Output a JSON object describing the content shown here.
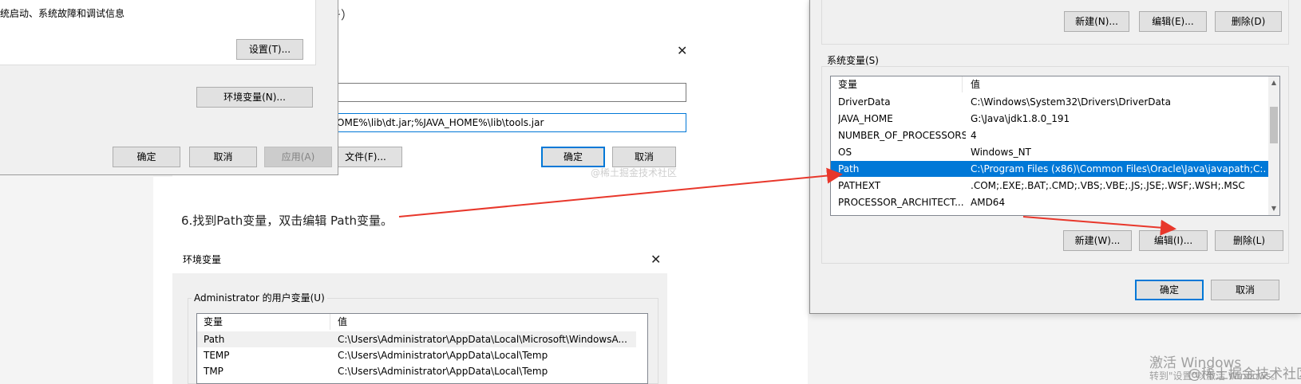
{
  "article": {
    "step_text": "6.找到Path变量，双击编辑 Path变量。",
    "top_snippet": "号）",
    "watermark": "@稀土掘金技术社区"
  },
  "sys_props": {
    "startup_text": "统启动、系统故障和调试信息",
    "settings_button": "设置(T)...",
    "env_vars_button": "环境变量(N)...",
    "ok": "确定",
    "cancel": "取消",
    "apply": "应用(A)"
  },
  "edit_var_dialog": {
    "name_value": "",
    "value_value": "HOME%\\lib\\dt.jar;%JAVA_HOME%\\lib\\tools.jar",
    "browse_file_button": "文件(F)...",
    "ok": "确定",
    "cancel": "取消"
  },
  "env_dialog_bottom": {
    "title": "环境变量",
    "user_vars_label": "Administrator 的用户变量(U)",
    "col_variable": "变量",
    "col_value": "值",
    "rows": [
      {
        "name": "Path",
        "value": "C:\\Users\\Administrator\\AppData\\Local\\Microsoft\\WindowsA..."
      },
      {
        "name": "TEMP",
        "value": "C:\\Users\\Administrator\\AppData\\Local\\Temp"
      },
      {
        "name": "TMP",
        "value": "C:\\Users\\Administrator\\AppData\\Local\\Temp"
      }
    ]
  },
  "env_dialog_right": {
    "user_new_button": "新建(N)...",
    "user_edit_button": "编辑(E)...",
    "user_delete_button": "删除(D)",
    "system_vars_label": "系统变量(S)",
    "col_variable": "变量",
    "col_value": "值",
    "rows": [
      {
        "name": "DriverData",
        "value": "C:\\Windows\\System32\\Drivers\\DriverData"
      },
      {
        "name": "JAVA_HOME",
        "value": "G:\\Java\\jdk1.8.0_191"
      },
      {
        "name": "NUMBER_OF_PROCESSORS",
        "value": "4"
      },
      {
        "name": "OS",
        "value": "Windows_NT"
      },
      {
        "name": "Path",
        "value": "C:\\Program Files (x86)\\Common Files\\Oracle\\Java\\javapath;C:..."
      },
      {
        "name": "PATHEXT",
        "value": ".COM;.EXE;.BAT;.CMD;.VBS;.VBE;.JS;.JSE;.WSF;.WSH;.MSC"
      },
      {
        "name": "PROCESSOR_ARCHITECT...",
        "value": "AMD64"
      }
    ],
    "selected_row": 4,
    "sys_new_button": "新建(W)...",
    "sys_edit_button": "编辑(I)...",
    "sys_delete_button": "删除(L)",
    "ok": "确定",
    "cancel": "取消"
  },
  "activation": {
    "line1": "激活 Windows",
    "line2": "转到\"设置\"以激活 Windows。"
  },
  "colors": {
    "selection": "#0078d7",
    "arrow": "#e8372b"
  }
}
